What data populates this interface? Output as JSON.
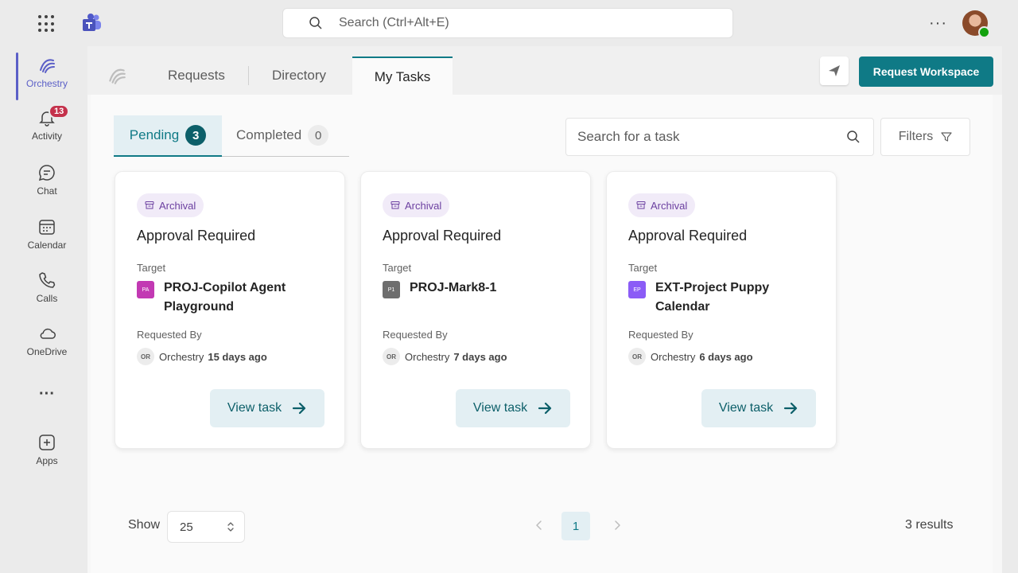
{
  "top_bar": {
    "search_placeholder": "Search (Ctrl+Alt+E)",
    "more_label": "···"
  },
  "rail": {
    "items": [
      {
        "label": "Orchestry",
        "icon": "orchestry-icon",
        "active": true
      },
      {
        "label": "Activity",
        "icon": "bell-icon",
        "badge": "13"
      },
      {
        "label": "Chat",
        "icon": "chat-icon"
      },
      {
        "label": "Calendar",
        "icon": "calendar-icon"
      },
      {
        "label": "Calls",
        "icon": "phone-icon"
      },
      {
        "label": "OneDrive",
        "icon": "cloud-icon"
      },
      {
        "label": "···",
        "icon": "more-icon"
      },
      {
        "label": "Apps",
        "icon": "add-app-icon"
      }
    ]
  },
  "app": {
    "tabs": [
      "Requests",
      "Directory",
      "My Tasks"
    ],
    "active_tab": "My Tasks",
    "request_workspace_label": "Request Workspace"
  },
  "tasks": {
    "subtabs": [
      {
        "label": "Pending",
        "count": "3"
      },
      {
        "label": "Completed",
        "count": "0"
      }
    ],
    "search_placeholder": "Search for a task",
    "filters_label": "Filters",
    "target_label": "Target",
    "requested_by_label": "Requested By",
    "view_task_label": "View task",
    "cards": [
      {
        "tag": "Archival",
        "title": "Approval Required",
        "target_initials": "PA",
        "target_color": "#c239b3",
        "target_name": "PROJ-Copilot Agent Playground",
        "requester_initials": "OR",
        "requester": "Orchestry",
        "time": "15 days ago"
      },
      {
        "tag": "Archival",
        "title": "Approval Required",
        "target_initials": "P1",
        "target_color": "#6e6e6e",
        "target_name": "PROJ-Mark8-1",
        "requester_initials": "OR",
        "requester": "Orchestry",
        "time": "7 days ago"
      },
      {
        "tag": "Archival",
        "title": "Approval Required",
        "target_initials": "EP",
        "target_color": "#8b5cf6",
        "target_name": "EXT-Project Puppy Calendar",
        "requester_initials": "OR",
        "requester": "Orchestry",
        "time": "6 days ago"
      }
    ]
  },
  "footer": {
    "show_label": "Show",
    "page_size": "25",
    "current_page": "1",
    "results": "3 results"
  },
  "colors": {
    "accent": "#0f7a86",
    "teams_purple": "#5b5fc7",
    "tag_purple": "#6b3fa0"
  }
}
